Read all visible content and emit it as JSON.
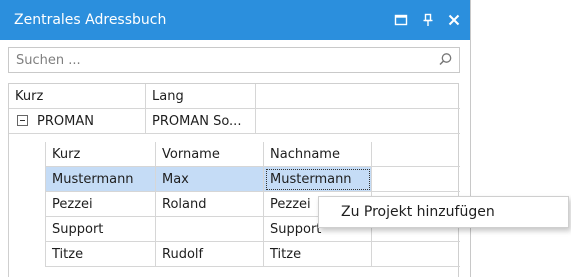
{
  "panel": {
    "title": "Zentrales Adressbuch",
    "accent": "#2b8fdd",
    "buttons": [
      "window-icon",
      "pin-icon",
      "close-icon"
    ]
  },
  "search": {
    "placeholder": "Suchen ...",
    "icon": "search-icon"
  },
  "outer_grid": {
    "columns": [
      "Kurz",
      "Lang"
    ],
    "rows": [
      {
        "kurz": "PROMAN",
        "lang": "PROMAN So...",
        "expanded": true
      }
    ]
  },
  "detail_grid": {
    "columns": [
      "Kurz",
      "Vorname",
      "Nachname"
    ],
    "rows": [
      {
        "kurz": "Mustermann",
        "vorname": "Max",
        "nachname": "Mustermann",
        "selected": true
      },
      {
        "kurz": "Pezzei",
        "vorname": "Roland",
        "nachname": "Pezzei"
      },
      {
        "kurz": "Support",
        "vorname": "",
        "nachname": "Support"
      },
      {
        "kurz": "Titze",
        "vorname": "Rudolf",
        "nachname": "Titze"
      }
    ]
  },
  "context_menu": {
    "items": [
      "Zu Projekt hinzufügen"
    ]
  }
}
